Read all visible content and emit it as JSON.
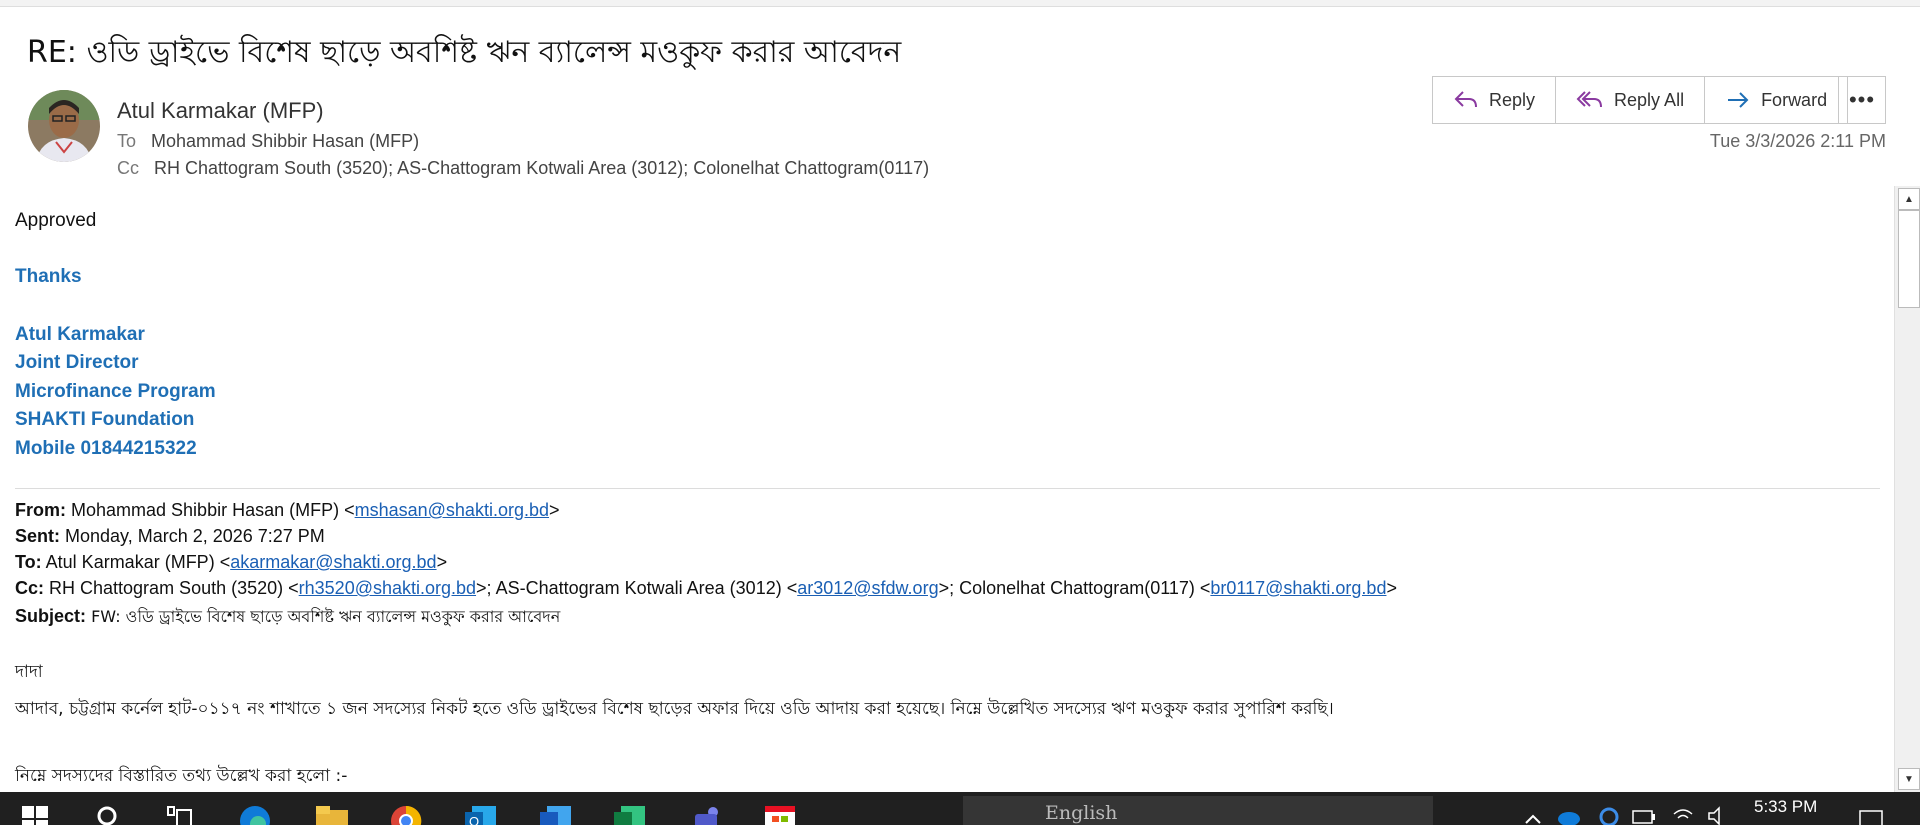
{
  "subject": "RE:  ওডি ড্রাইভে  বিশেষ ছাড়ে অবশিষ্ট ঋন ব্যালেন্স মওকুফ করার আবেদন",
  "header": {
    "sender": "Atul  Karmakar (MFP)",
    "to_label": "To",
    "to": "Mohammad Shibbir Hasan (MFP)",
    "cc_label": "Cc",
    "cc": "RH Chattogram South (3520); AS-Chattogram  Kotwali Area (3012); Colonelhat Chattogram(0117)",
    "date": "Tue 3/3/2026 2:11 PM"
  },
  "actions": {
    "reply": "Reply",
    "reply_all": "Reply All",
    "forward": "Forward",
    "more": "•••"
  },
  "body": {
    "approved": "Approved",
    "thanks": "Thanks",
    "signature": [
      "Atul Karmakar",
      "Joint Director",
      "Microfinance Program",
      "SHAKTI Foundation",
      "Mobile 01844215322"
    ],
    "forward": {
      "from_label": "From:",
      "from_name": " Mohammad Shibbir Hasan (MFP) <",
      "from_email": "mshasan@shakti.org.bd",
      "sent_label": "Sent:",
      "sent": " Monday, March 2, 2026 7:27 PM",
      "to_label": "To:",
      "to_name": " Atul Karmakar (MFP) <",
      "to_email": "akarmakar@shakti.org.bd",
      "cc_label": "Cc:",
      "cc_1": " RH Chattogram South (3520) <",
      "cc_email_1": "rh3520@shakti.org.bd",
      "cc_2": ">; AS-Chattogram Kotwali Area (3012) <",
      "cc_email_2": "ar3012@sfdw.org",
      "cc_3": ">; Colonelhat Chattogram(0117) <",
      "cc_email_3": "br0117@shakti.org.bd",
      "subject_label": "Subject:",
      "subject": " FW: ওডি  ড্রাইভে  বিশেষ  ছাড়ে  অবশিষ্ট  ঋন  ব্যালেন্স  মওকুফ  করার  আবেদন"
    },
    "greeting": "দাদা",
    "para1": "আদাব, চট্টগ্রাম কর্নেল হাট-০১১৭ নং শাখাতে  ১ জন  সদস্যের নিকট হতে ওডি ড্রাইভের বিশেষ ছাড়ের অফার দিয়ে ওডি আদায় করা হয়েছে। নিম্নে উল্লেখিত সদস্যের  ঋণ মওকুফ করার সুপারিশ করছি।",
    "para2": "নিম্নে সদস্যদের বিস্তারিত তথ্য উল্লেখ করা হলো :-"
  },
  "taskbar": {
    "language": "English",
    "time": "5:33 PM"
  }
}
